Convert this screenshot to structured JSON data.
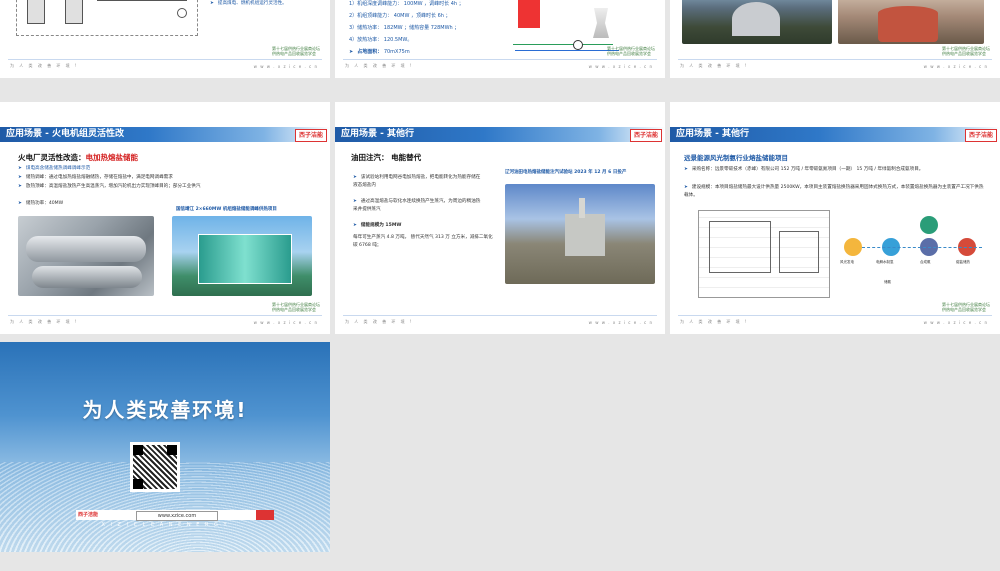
{
  "page": {
    "footer_left": "为 人 类 改 善 环 境 !",
    "footer_right": "w w w . x z i c e . c n",
    "badge_line1": "第十七届供热行业展商论坛",
    "badge_line2": "供热电产品回收展览学会"
  },
  "top_row": {
    "slide1": {
      "bullet": "提高煤电、燃机机组运行灵活性。"
    },
    "slide2": {
      "lines": [
        "1）机组深度调峰能力： 100MW ，调峰时长 4h ；",
        "2）机组顶峰能力：  40MW  ，顶峰时长 6h ；",
        "3）储热功率：  182MW ；储热容量 728MWh ；",
        "4）放热功率：  120.5MW。"
      ],
      "area_label": "占地面积：",
      "area_value": "70mX75m"
    }
  },
  "slide4": {
    "title": "应用场景 - 火电机组灵活性改",
    "logo": "西子洁能",
    "heading_prefix": "火电厂灵活性改造：",
    "heading_red": "电加热熔盐储能",
    "bullets": [
      "煤电高含储盐储热调峰调峰示范",
      "储热调峰：通过电加热熔盐熔融储热，存储在熔盐中，满足电网调峰需求",
      "放热顶峰：高温熔盐放热产生高温蒸汽，增加汽轮机出力实现顶峰目的；部分工业供汽"
    ],
    "power_label": "储热功率：40MW",
    "photo_caption": "国信靖江 2×660MW 机组熔盐储能调峰供热项目"
  },
  "slide5": {
    "title": "应用场景 - 其他行",
    "logo": "西子洁能",
    "heading": "油田注汽：  电能替代",
    "bullets": [
      "该试验站利用电网谷电加热熔盐，把电能转化为热能存储在液态熔盐内",
      "通过高温熔盐与软化水连续换热产生蒸汽，为周边的稠油热采井提供蒸汽",
      "储能规模为 15MW"
    ],
    "desc": "每年可生产蒸汽 4.8 万吨， 替代天然气 313 万 立方米，减排二氧化碳 6768 吨；",
    "caption": "辽河油田电热熔盐储能注汽试验站  2023 年 12 月 6 日投产"
  },
  "slide6": {
    "title": "应用场景 - 其他行",
    "logo": "西子洁能",
    "heading": "远景能源风光制氨行业熔盐储能项目",
    "bullets": [
      "采购名称：远景零碳技术（赤峰）有限公司 152 万吨 / 年零碳氨氮项目（一期） 15 万吨 / 年绿氨制合成氨项目。",
      "建设规模：本项目熔盐储热最大设计供热量 2500KW，本项目主装置熔盐换热器采用固体式换热方式，本装置熔盐换热器为主装置产工况下供热载体。"
    ],
    "node_labels": [
      "风光发电",
      "电解水制氢",
      "合成氨",
      "储氨",
      "熔盐储热"
    ]
  },
  "closing": {
    "slogan": "为人类改善环境!",
    "website": "www.xzice.com",
    "logo": "西子洁能",
    "subtitle": "X I Z I C L E A N  E N E R G Y"
  }
}
